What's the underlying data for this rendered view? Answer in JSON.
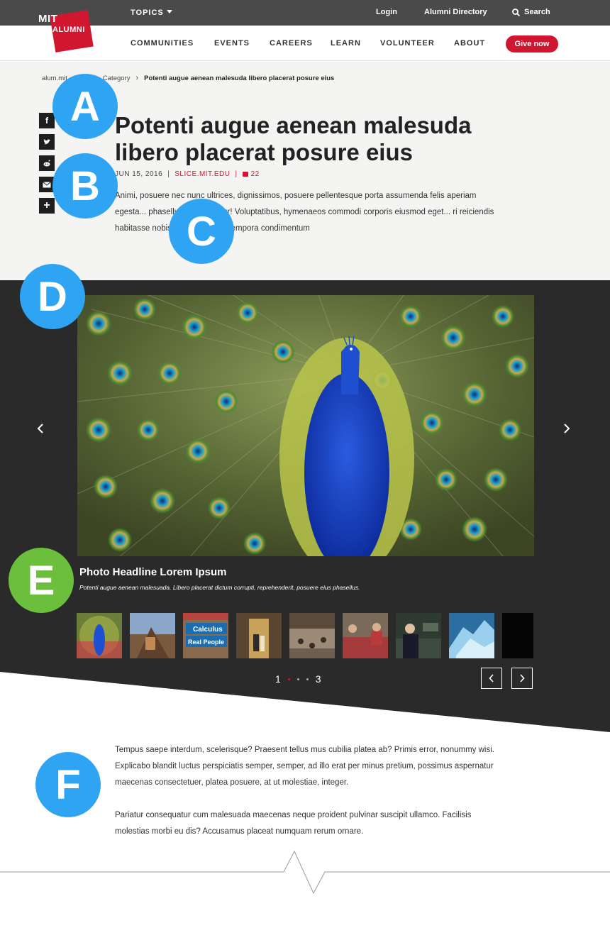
{
  "topbar": {
    "topics_label": "TOPICS",
    "login_label": "Login",
    "directory_label": "Alumni Directory",
    "search_label": "Search"
  },
  "logo": {
    "line1": "MIT",
    "line2": "ALUMNI"
  },
  "nav": {
    "items": [
      "COMMUNITIES",
      "EVENTS",
      "CAREERS",
      "LEARN",
      "VOLUNTEER",
      "ABOUT"
    ],
    "give_label": "Give now"
  },
  "breadcrumb": {
    "root": "alum.mit",
    "category": "Category",
    "current": "Potenti augue aenean malesuda libero placerat posure eius"
  },
  "article": {
    "title_line1": "Potenti augue aenean malesuda",
    "title_line2": "libero placerat posure eius",
    "date": "JUN 15, 2016",
    "source": "SLICE.MIT.EDU",
    "comments": "22",
    "intro": "Animi, posuere nec nunc ultrices, dignissimos, posuere pellentesque porta assumenda felis aperiam egesta... phasellus consequatur! Voluptatibus, hymenaeos commodi corporis eiusmod eget... ri reiciendis habitasse nobis voluptates sed tempora condimentum"
  },
  "gallery": {
    "caption_title": "Photo Headline Lorem Ipsum",
    "caption_text": "Potenti augue aenean malesuada. Libero placerat dictum corrupti, reprehenderit, posuere eius phasellus.",
    "thumb_sign_top": "Calculus",
    "thumb_sign_bottom": "Real People",
    "pager_start": "1",
    "pager_end": "3"
  },
  "body": {
    "p1": "Tempus saepe interdum, scelerisque? Praesent tellus mus cubilia platea ab? Primis error, nonummy wisi. Explicabo blandit luctus perspiciatis semper, semper, ad illo erat per minus pretium, possimus aspernatur maecenas consectetuer, platea posuere, at ut molestiae, integer.",
    "p2": "Pariatur consequatur cum malesuada maecenas neque proident pulvinar suscipit ullamco. Facilisis molestias morbi eu dis? Accusamus placeat numquam rerum ornare."
  },
  "markers": [
    "A",
    "B",
    "C",
    "D",
    "E",
    "F"
  ],
  "colors": {
    "brand_red": "#d1162f",
    "marker_blue": "#2fa4f3",
    "marker_green": "#6cbf3c",
    "dark_bg": "#2a2a2a"
  }
}
